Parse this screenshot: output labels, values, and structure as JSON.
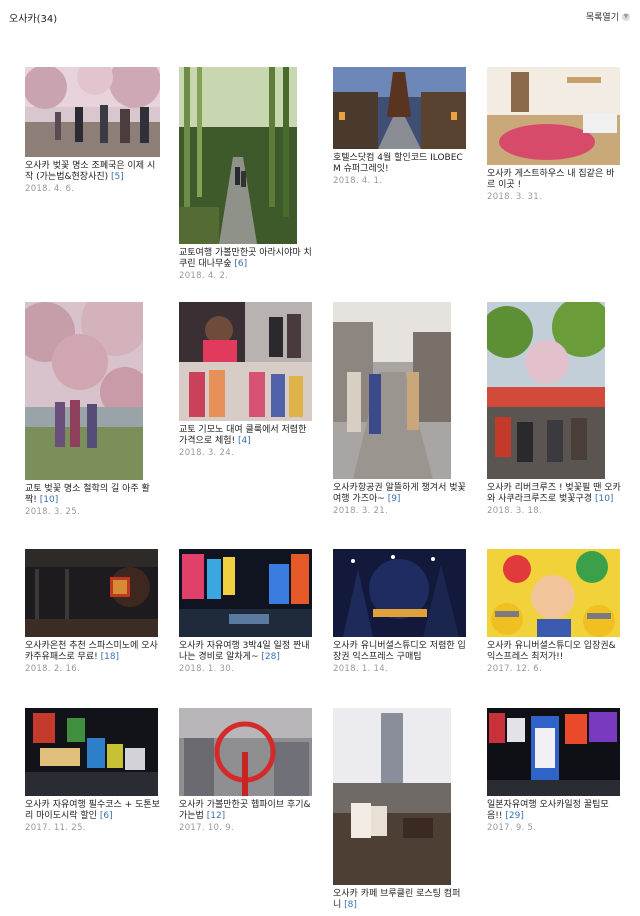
{
  "header": {
    "title": "오사카",
    "count": "(34)",
    "list_toggle": "목록열기"
  },
  "posts": [
    {
      "title": "오사카 벚꽃 명소 조폐국은 이제 시작 (가는법&현장사진)",
      "comments": "[5]",
      "date": "2018. 4. 6."
    },
    {
      "title": "교토여행 가볼만한곳 아라시야마 치쿠린 대나무숲",
      "comments": "[6]",
      "date": "2018. 4. 2."
    },
    {
      "title": "호텔스닷컴 4월 할인코드 ILOBECM 슈퍼그레잇!",
      "comments": "",
      "date": "2018. 4. 1."
    },
    {
      "title": "오사카 게스트하우스 내 집같은 바르 이곳 !",
      "comments": "",
      "date": "2018. 3. 31."
    },
    {
      "title": "교토 벚꽃 명소 철학의 길 아주 활짝!",
      "comments": "[10]",
      "date": "2018. 3. 25."
    },
    {
      "title": "교토 기모노 대여 클룩에서 저렴한 가격으로 체험!",
      "comments": "[4]",
      "date": "2018. 3. 24."
    },
    {
      "title": "오사카항공권 알뜰하게 챙겨서 벚꽃여행 가즈아~",
      "comments": "[9]",
      "date": "2018. 3. 21."
    },
    {
      "title": "오사카 리버크루즈 ! 벚꽃필 땐 오카와 사쿠라크루즈로 벚꽃구경",
      "comments": "[10]",
      "date": "2018. 3. 18."
    },
    {
      "title": "오사카온천 추천 스파스미노에 오사카주유패스로 무료!",
      "comments": "[18]",
      "date": "2018. 2. 16."
    },
    {
      "title": "오사카 자유여행 3박4일 일정 짠내나는 경비로 알차게~",
      "comments": "[28]",
      "date": "2018. 1. 30."
    },
    {
      "title": "오사카 유니버셜스튜디오 저렴한 입장권 익스프레스 구매팁",
      "comments": "",
      "date": "2018. 1. 14."
    },
    {
      "title": "오사카 유니버셜스튜디오 입장권&익스프레스 최저가!!",
      "comments": "",
      "date": "2017. 12. 6."
    },
    {
      "title": "오사카 자유여행 필수코스 + 도톤보리 마이도시락 할인",
      "comments": "[6]",
      "date": "2017. 11. 25."
    },
    {
      "title": "오사카 가볼만한곳 헵파이브 후기&가는법",
      "comments": "[12]",
      "date": "2017. 10. 9."
    },
    {
      "title": "오사카 카페 브루클린 로스팅 컴퍼니",
      "comments": "[8]",
      "date": ""
    },
    {
      "title": "일본자유여행 오사카일정 꿀팁모음!!",
      "comments": "[29]",
      "date": "2017. 9. 5."
    }
  ]
}
